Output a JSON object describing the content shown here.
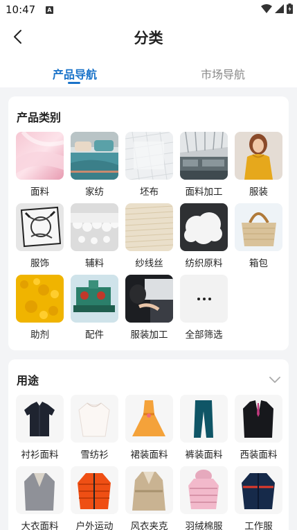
{
  "status_bar": {
    "time": "10:47",
    "notif_glyph": "A"
  },
  "header": {
    "title": "分类",
    "back_icon": "chevron-left-icon"
  },
  "tabs": [
    {
      "label": "产品导航",
      "active": true
    },
    {
      "label": "市场导航",
      "active": false
    }
  ],
  "product_section": {
    "title": "产品类别",
    "items": [
      {
        "label": "面料",
        "icon": "pink-silk-fabric-photo"
      },
      {
        "label": "家纺",
        "icon": "bedding-photo"
      },
      {
        "label": "坯布",
        "icon": "white-greige-fabric-photo"
      },
      {
        "label": "面料加工",
        "icon": "textile-factory-photo"
      },
      {
        "label": "服装",
        "icon": "woman-sweater-photo"
      },
      {
        "label": "服饰",
        "icon": "silk-scarf-photo"
      },
      {
        "label": "辅料",
        "icon": "lace-trim-photo"
      },
      {
        "label": "纱线丝",
        "icon": "yarn-cone-photo"
      },
      {
        "label": "纺织原料",
        "icon": "cotton-fiber-photo"
      },
      {
        "label": "箱包",
        "icon": "straw-bag-photo"
      },
      {
        "label": "助剂",
        "icon": "yellow-powder-photo"
      },
      {
        "label": "配件",
        "icon": "machine-part-photo"
      },
      {
        "label": "服装加工",
        "icon": "sewing-photo"
      },
      {
        "label": "全部筛选",
        "icon": "more-dots-icon"
      }
    ]
  },
  "usage_section": {
    "title": "用途",
    "items": [
      {
        "label": "衬衫面料",
        "icon": "shirt-photo"
      },
      {
        "label": "雪纺衫",
        "icon": "chiffon-blouse-photo"
      },
      {
        "label": "裙装面料",
        "icon": "dress-photo"
      },
      {
        "label": "裤装面料",
        "icon": "trousers-photo"
      },
      {
        "label": "西装面料",
        "icon": "suit-photo"
      },
      {
        "label": "大衣面料",
        "icon": "coat-photo"
      },
      {
        "label": "户外运动",
        "icon": "outdoor-jacket-photo"
      },
      {
        "label": "风衣夹克",
        "icon": "trench-coat-photo"
      },
      {
        "label": "羽绒棉服",
        "icon": "down-jacket-photo"
      },
      {
        "label": "工作服",
        "icon": "workwear-photo"
      }
    ]
  },
  "colors": {
    "accent": "#1a73c9",
    "background": "#f3f4f6"
  }
}
